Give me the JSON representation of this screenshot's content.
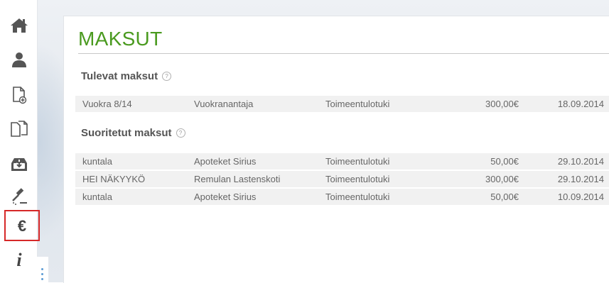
{
  "sidebar": {
    "items": [
      {
        "name": "home",
        "icon": "home-icon"
      },
      {
        "name": "profile",
        "icon": "user-icon"
      },
      {
        "name": "new-document",
        "icon": "document-add-icon"
      },
      {
        "name": "documents",
        "icon": "documents-icon"
      },
      {
        "name": "inbox",
        "icon": "inbox-download-icon"
      },
      {
        "name": "decisions",
        "icon": "gavel-icon"
      },
      {
        "name": "payments",
        "icon": "euro-icon",
        "active": true
      },
      {
        "name": "info",
        "icon": "info-icon"
      }
    ],
    "active_color": "#d62828"
  },
  "page": {
    "title": "MAKSUT",
    "title_color": "#4a9a1f"
  },
  "upcoming": {
    "heading": "Tulevat maksut",
    "help": "?",
    "rows": [
      {
        "description": "Vuokra 8/14",
        "recipient": "Vuokranantaja",
        "type": "Toimeentulotuki",
        "amount": "300,00€",
        "date": "18.09.2014"
      }
    ]
  },
  "completed": {
    "heading": "Suoritetut maksut",
    "help": "?",
    "rows": [
      {
        "description": "kuntala",
        "recipient": "Apoteket Sirius",
        "type": "Toimeentulotuki",
        "amount": "50,00€",
        "date": "29.10.2014"
      },
      {
        "description": "HEI NÄKYYKÖ",
        "recipient": "Remulan Lastenskoti",
        "type": "Toimeentulotuki",
        "amount": "300,00€",
        "date": "29.10.2014"
      },
      {
        "description": "kuntala",
        "recipient": "Apoteket Sirius",
        "type": "Toimeentulotuki",
        "amount": "50,00€",
        "date": "10.09.2014"
      }
    ]
  }
}
